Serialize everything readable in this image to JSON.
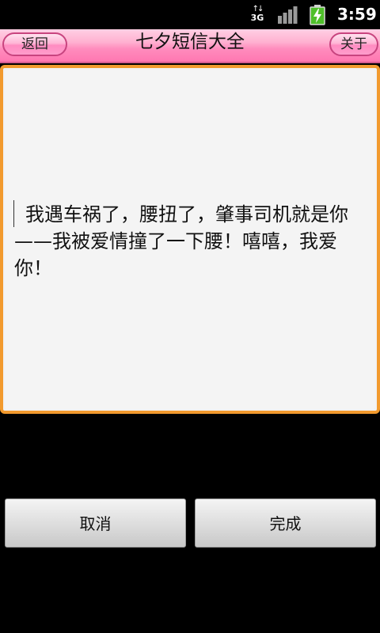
{
  "status_bar": {
    "network": "3G",
    "time": "3:59"
  },
  "header": {
    "back_label": "返回",
    "title": "七夕短信大全",
    "about_label": "关于"
  },
  "message": {
    "text": "我遇车祸了，腰扭了，肇事司机就是你——我被爱情撞了一下腰！嘻嘻，我爱你！"
  },
  "actions": {
    "cancel_label": "取消",
    "done_label": "完成"
  },
  "colors": {
    "title_bar": "#ff8cbd",
    "frame_border": "#f29a2e",
    "background": "#000000"
  }
}
